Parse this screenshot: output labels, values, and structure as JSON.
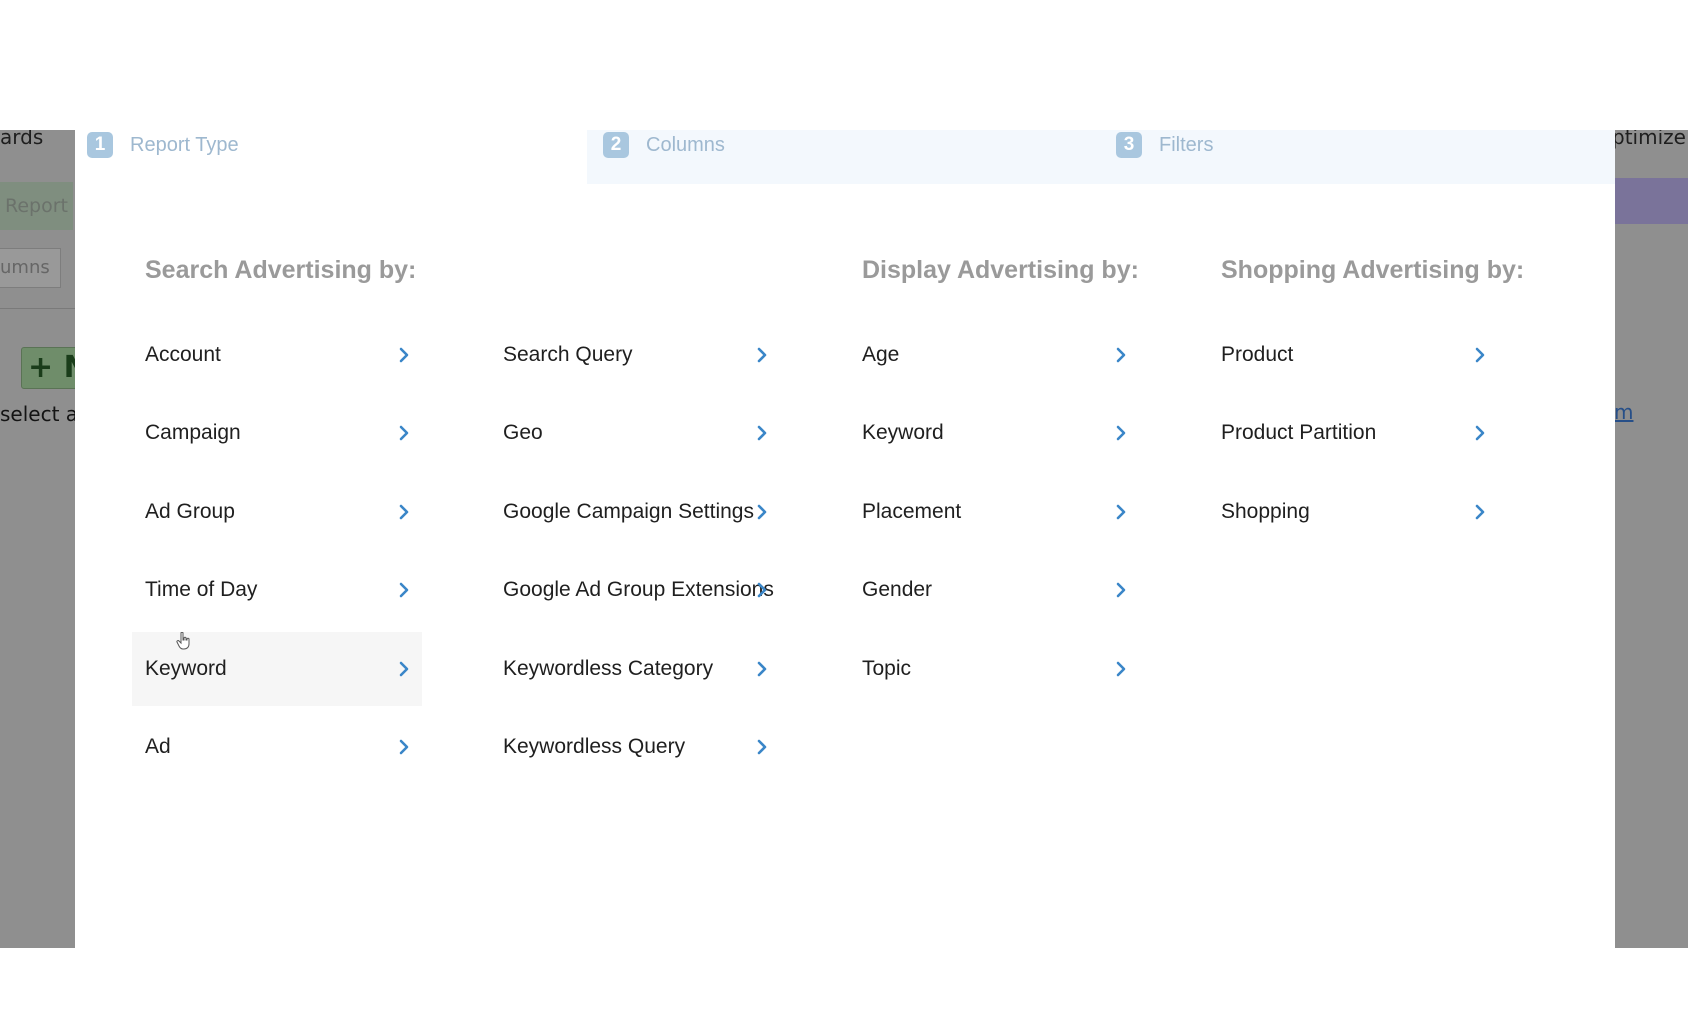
{
  "background": {
    "left_tab_text": "ards",
    "report_tab": "Report",
    "columns_button": "umns",
    "new_button": "+ N",
    "select_text": "select a",
    "right_tab_text": "ptimize",
    "right_link": "m"
  },
  "steps": [
    {
      "number": "1",
      "label": "Report Type"
    },
    {
      "number": "2",
      "label": "Columns"
    },
    {
      "number": "3",
      "label": "Filters"
    }
  ],
  "sections": {
    "search": {
      "heading": "Search Advertising by:",
      "col1": [
        "Account",
        "Campaign",
        "Ad Group",
        "Time of Day",
        "Keyword",
        "Ad"
      ],
      "col2": [
        "Search Query",
        "Geo",
        "Google Campaign Settings",
        "Google Ad Group Extensions",
        "Keywordless Category",
        "Keywordless Query"
      ]
    },
    "display": {
      "heading": "Display Advertising by:",
      "items": [
        "Age",
        "Keyword",
        "Placement",
        "Gender",
        "Topic"
      ]
    },
    "shopping": {
      "heading": "Shopping Advertising by:",
      "items": [
        "Product",
        "Product Partition",
        "Shopping"
      ]
    }
  },
  "hovered_item": "Keyword",
  "colors": {
    "accent_blue": "#3a86c8",
    "step_badge": "#a9c7df",
    "heading_gray": "#9a9a9a",
    "overlay_gray": "#8f8f8f"
  },
  "icons": {
    "chevron": "chevron-right-icon",
    "cursor": "hand-pointer-icon"
  }
}
